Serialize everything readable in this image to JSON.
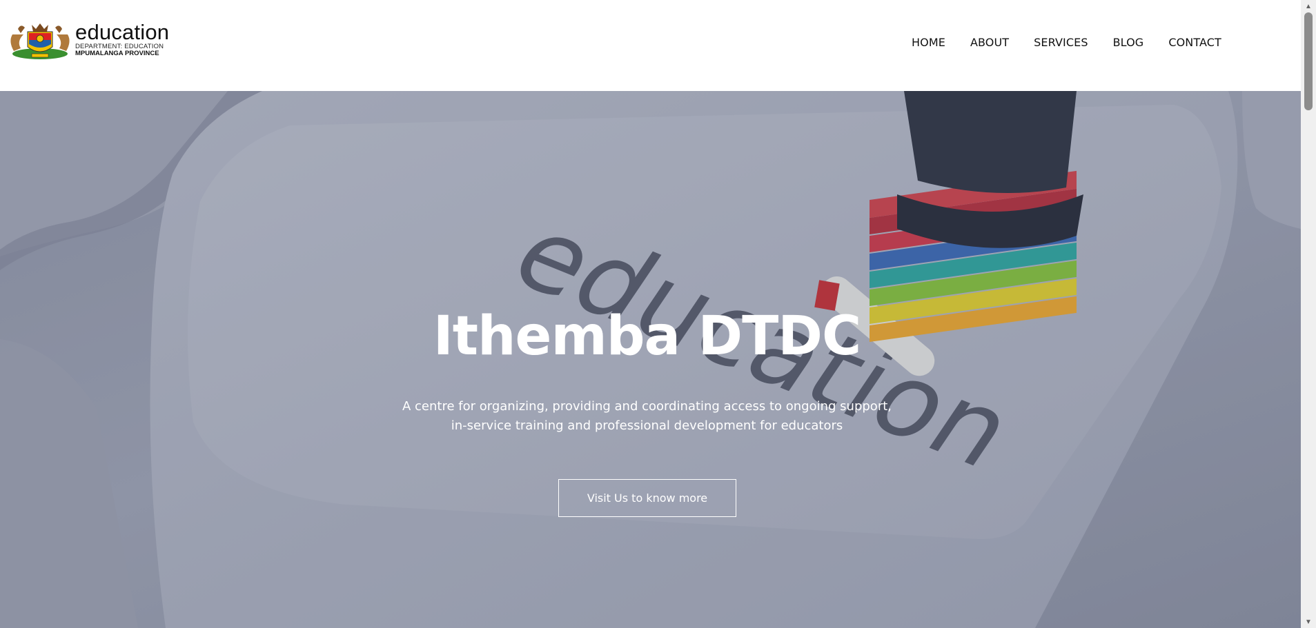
{
  "header": {
    "logo": {
      "word": "education",
      "line1": "DEPARTMENT: EDUCATION",
      "line2": "MPUMALANGA PROVINCE"
    },
    "nav": [
      {
        "label": "HOME"
      },
      {
        "label": "ABOUT"
      },
      {
        "label": "SERVICES"
      },
      {
        "label": "BLOG"
      },
      {
        "label": "CONTACT"
      }
    ]
  },
  "hero": {
    "title": "Ithemba DTDC",
    "description_line1": "A centre for organizing, providing and coordinating access to ongoing support,",
    "description_line2": "in-service training and professional development for educators",
    "button_label": "Visit Us to know more",
    "background_key_text": "education"
  },
  "colors": {
    "hero_overlay": "#8b90a2",
    "text_white": "#ffffff",
    "nav_text": "#111111"
  }
}
